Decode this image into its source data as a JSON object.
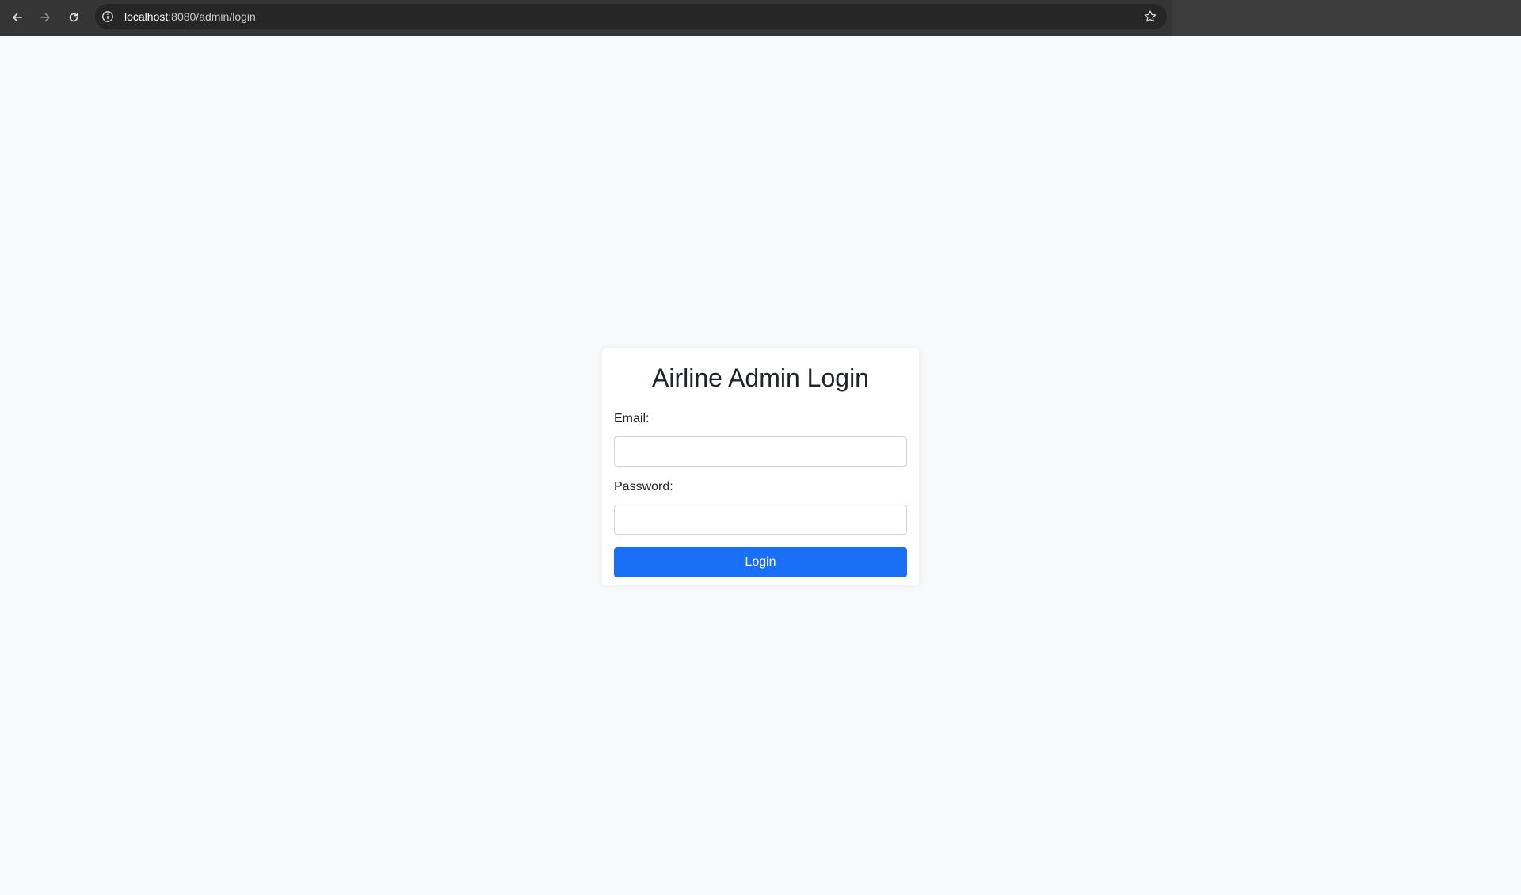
{
  "browser": {
    "url_host": "localhost",
    "url_path": ":8080/admin/login",
    "icons": {
      "back": "back-arrow-icon",
      "forward": "forward-arrow-icon",
      "reload": "reload-icon",
      "site_info": "info-icon",
      "bookmark": "star-icon"
    }
  },
  "login": {
    "title": "Airline Admin Login",
    "email_label": "Email:",
    "email_value": "",
    "password_label": "Password:",
    "password_value": "",
    "submit_label": "Login"
  },
  "colors": {
    "page_background": "#f8f9fa",
    "primary_button": "#1a6ff7",
    "text": "#212529"
  }
}
